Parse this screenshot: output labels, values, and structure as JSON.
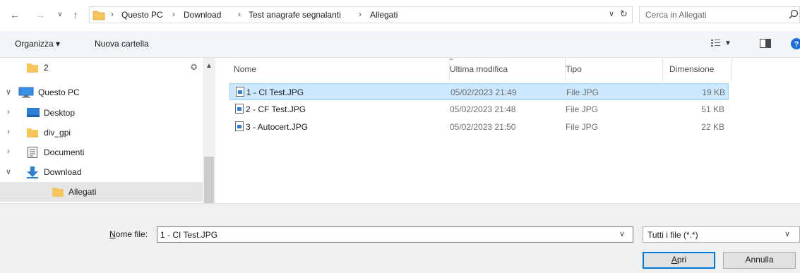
{
  "address": {
    "breadcrumbs": [
      "Questo PC",
      "Download",
      "Test anagrafe segnalanti",
      "Allegati"
    ],
    "search_placeholder": "Cerca in Allegati"
  },
  "toolbar": {
    "organize_label": "Organizza ▾",
    "new_folder_label": "Nuova cartella"
  },
  "navpane": {
    "items": [
      {
        "label": "2",
        "icon": "folder-icon",
        "level": 0
      },
      {
        "label": "Questo PC",
        "icon": "computer-icon",
        "level": 0
      },
      {
        "label": "Desktop",
        "icon": "desktop-icon",
        "level": 1
      },
      {
        "label": "div_gpi",
        "icon": "folder-icon",
        "level": 1
      },
      {
        "label": "Documenti",
        "icon": "documents-icon",
        "level": 1
      },
      {
        "label": "Download",
        "icon": "download-icon",
        "level": 1
      },
      {
        "label": "Allegati",
        "icon": "folder-icon",
        "level": 2
      }
    ]
  },
  "filelist": {
    "columns": [
      "Nome",
      "Ultima modifica",
      "Tipo",
      "Dimensione"
    ],
    "rows": [
      {
        "name": "1 - CI Test.JPG",
        "modified": "05/02/2023 21:49",
        "type": "File JPG",
        "size": "19 KB",
        "selected": true
      },
      {
        "name": "2 - CF Test.JPG",
        "modified": "05/02/2023 21:48",
        "type": "File JPG",
        "size": "51 KB",
        "selected": false
      },
      {
        "name": "3 - Autocert.JPG",
        "modified": "05/02/2023 21:50",
        "type": "File JPG",
        "size": "22 KB",
        "selected": false
      }
    ]
  },
  "bottom": {
    "filename_label_underlined": "N",
    "filename_label_rest": "ome file:",
    "filename_value": "1 - CI Test.JPG",
    "filetype_value": "Tutti i file (*.*)",
    "open_label_underlined": "A",
    "open_label_rest": "pri",
    "cancel_label": "Annulla"
  },
  "colors": {
    "selection_bg": "#cce8ff",
    "selection_border": "#99d1ff",
    "primary_button_border": "#0078d7",
    "toolbar_bg": "#f1f5f9"
  }
}
